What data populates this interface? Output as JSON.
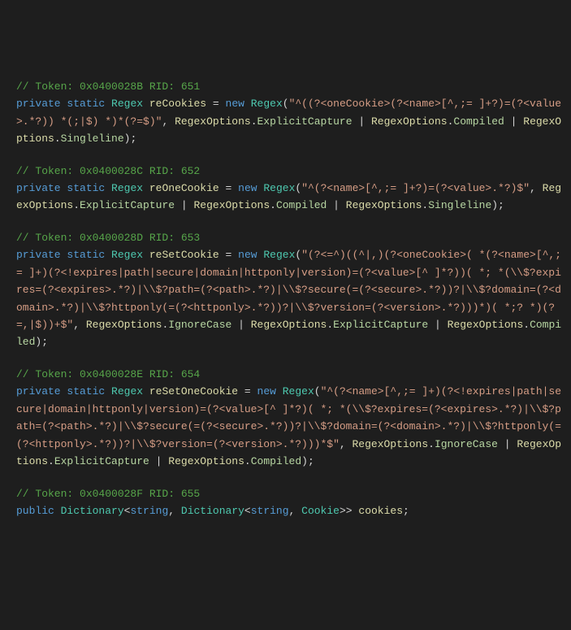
{
  "blocks": [
    {
      "comment": "// Token: 0x0400028B RID: 651",
      "mod1": "private",
      "mod2": "static",
      "type": "Regex",
      "name": "reCookies",
      "new": "new",
      "ctor": "Regex",
      "pattern": "\"^((?<oneCookie>(?<name>[^,;= ]+?)=(?<value>.*?)) *(;|$) *)*(?=$)\"",
      "opts": [
        "ExplicitCapture",
        "Compiled",
        "Singleline"
      ]
    },
    {
      "comment": "// Token: 0x0400028C RID: 652",
      "mod1": "private",
      "mod2": "static",
      "type": "Regex",
      "name": "reOneCookie",
      "new": "new",
      "ctor": "Regex",
      "pattern": "\"^(?<name>[^,;= ]+?)=(?<value>.*?)$\"",
      "opts": [
        "ExplicitCapture",
        "Compiled",
        "Singleline"
      ]
    },
    {
      "comment": "// Token: 0x0400028D RID: 653",
      "mod1": "private",
      "mod2": "static",
      "type": "Regex",
      "name": "reSetCookie",
      "new": "new",
      "ctor": "Regex",
      "pattern": "\"(?<=^)((^|,)(?<oneCookie>( *(?<name>[^,;= ]+)(?<!expires|path|secure|domain|httponly|version)=(?<value>[^ ]*?))( *; *(\\\\$?expires=(?<expires>.*?)|\\\\$?path=(?<path>.*?)|\\\\$?secure(=(?<secure>.*?))?|\\\\$?domain=(?<domain>.*?)|\\\\$?httponly(=(?<httponly>.*?))?|\\\\$?version=(?<version>.*?)))*)( *;? *)(?=,|$))+$\"",
      "opts": [
        "IgnoreCase",
        "ExplicitCapture",
        "Compiled"
      ]
    },
    {
      "comment": "// Token: 0x0400028E RID: 654",
      "mod1": "private",
      "mod2": "static",
      "type": "Regex",
      "name": "reSetOneCookie",
      "new": "new",
      "ctor": "Regex",
      "pattern": "\"^(?<name>[^,;= ]+)(?<!expires|path|secure|domain|httponly|version)=(?<value>[^ ]*?)( *; *(\\\\$?expires=(?<expires>.*?)|\\\\$?path=(?<path>.*?)|\\\\$?secure(=(?<secure>.*?))?|\\\\$?domain=(?<domain>.*?)|\\\\$?httponly(=(?<httponly>.*?))?|\\\\$?version=(?<version>.*?)))*$\"",
      "opts": [
        "IgnoreCase",
        "ExplicitCapture",
        "Compiled"
      ]
    }
  ],
  "lastBlock": {
    "comment": "// Token: 0x0400028F RID: 655",
    "mod1": "public",
    "type1": "Dictionary",
    "gen1": "string",
    "type2": "Dictionary",
    "gen2": "string",
    "gen3": "Cookie",
    "name": "cookies"
  },
  "labels": {
    "regexOptions": "RegexOptions"
  }
}
